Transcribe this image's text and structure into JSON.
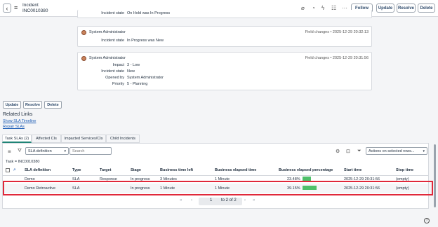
{
  "header": {
    "record_type": "Incident",
    "record_number": "INC0010380",
    "buttons": {
      "follow": "Follow",
      "update": "Update",
      "resolve": "Resolve",
      "delete": "Delete"
    },
    "icons": [
      "paperclip-icon",
      "activity-icon",
      "lightning-icon",
      "sliders-icon",
      "more-icon"
    ]
  },
  "activity": [
    {
      "author": "",
      "meta": "",
      "fields": [
        {
          "label": "Incident state",
          "value": "On Hold  was  In Progress"
        }
      ]
    },
    {
      "author": "System Administrator",
      "meta": "Field changes • 2025-12-29 20:32:13",
      "fields": [
        {
          "label": "Incident state",
          "value": "In Progress  was  New"
        }
      ]
    },
    {
      "author": "System Administrator",
      "meta": "Field changes • 2025-12-29 20:31:56",
      "fields": [
        {
          "label": "Impact",
          "value": "3 - Low"
        },
        {
          "label": "Incident state",
          "value": "New"
        },
        {
          "label": "Opened by",
          "value": "System Administrator"
        },
        {
          "label": "Priority",
          "value": "5 - Planning"
        }
      ]
    }
  ],
  "form_buttons": {
    "update": "Update",
    "resolve": "Resolve",
    "delete": "Delete"
  },
  "related_links": {
    "title": "Related Links",
    "links": [
      "Show SLA Timeline",
      "Repair SLAs"
    ]
  },
  "tabs": [
    "Task SLAs (2)",
    "Affected CIs",
    "Impacted Services/CIs",
    "Child Incidents"
  ],
  "list": {
    "search_field": "SLA definition",
    "search_placeholder": "Search",
    "actions_label": "Actions on selected rows...",
    "filter": "Task = INC0010380",
    "columns": [
      "SLA definition",
      "Type",
      "Target",
      "Stage",
      "Business time left",
      "Business elapsed time",
      "Business elapsed percentage",
      "Start time",
      "Stop time"
    ],
    "rows": [
      {
        "sla": "Demo",
        "type": "SLA",
        "target": "Response",
        "stage": "In progress",
        "time_left": "3 Minutes",
        "elapsed": "1 Minute",
        "pct_text": "23.48%",
        "pct": 23.48,
        "start": "2025-12-29 20:31:56",
        "stop": "(empty)"
      },
      {
        "sla": "Demo Retroactive",
        "type": "SLA",
        "target": "",
        "stage": "In progress",
        "time_left": "1 Minute",
        "elapsed": "1 Minute",
        "pct_text": "39.15%",
        "pct": 39.15,
        "start": "2025-12-29 20:31:56",
        "stop": "(empty)"
      }
    ],
    "pagination": {
      "first": "«",
      "prev": "‹",
      "current": "1",
      "of": "to 2 of 2",
      "next": "›",
      "last": "»"
    }
  },
  "colors": {
    "highlight": "#e0283a",
    "bar": "#4fc06a",
    "tab_active": "#1f8476"
  }
}
